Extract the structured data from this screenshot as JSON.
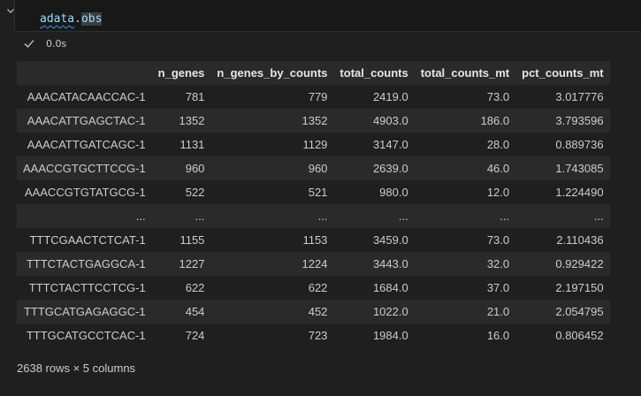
{
  "cell": {
    "code_var": "adata",
    "code_dot": ".",
    "code_attr": "obs",
    "exec_time": "0.0s"
  },
  "table": {
    "index_header": "",
    "columns": [
      "n_genes",
      "n_genes_by_counts",
      "total_counts",
      "total_counts_mt",
      "pct_counts_mt"
    ],
    "rows": [
      {
        "index": "AAACATACAACCAC-1",
        "cells": [
          "781",
          "779",
          "2419.0",
          "73.0",
          "3.017776"
        ]
      },
      {
        "index": "AAACATTGAGCTAC-1",
        "cells": [
          "1352",
          "1352",
          "4903.0",
          "186.0",
          "3.793596"
        ]
      },
      {
        "index": "AAACATTGATCAGC-1",
        "cells": [
          "1131",
          "1129",
          "3147.0",
          "28.0",
          "0.889736"
        ]
      },
      {
        "index": "AAACCGTGCTTCCG-1",
        "cells": [
          "960",
          "960",
          "2639.0",
          "46.0",
          "1.743085"
        ]
      },
      {
        "index": "AAACCGTGTATGCG-1",
        "cells": [
          "522",
          "521",
          "980.0",
          "12.0",
          "1.224490"
        ]
      },
      {
        "index": "...",
        "cells": [
          "...",
          "...",
          "...",
          "...",
          "..."
        ]
      },
      {
        "index": "TTTCGAACTCTCAT-1",
        "cells": [
          "1155",
          "1153",
          "3459.0",
          "73.0",
          "2.110436"
        ]
      },
      {
        "index": "TTTCTACTGAGGCA-1",
        "cells": [
          "1227",
          "1224",
          "3443.0",
          "32.0",
          "0.929422"
        ]
      },
      {
        "index": "TTTCTACTTCCTCG-1",
        "cells": [
          "622",
          "622",
          "1684.0",
          "37.0",
          "2.197150"
        ]
      },
      {
        "index": "TTTGCATGAGAGGC-1",
        "cells": [
          "454",
          "452",
          "1022.0",
          "21.0",
          "2.054795"
        ]
      },
      {
        "index": "TTTGCATGCCTCAC-1",
        "cells": [
          "724",
          "723",
          "1984.0",
          "16.0",
          "0.806452"
        ]
      }
    ]
  },
  "shape_note": "2638 rows × 5 columns",
  "icons": {
    "collapse": "chevron-down-icon",
    "status": "check-icon"
  },
  "colors": {
    "background": "#1f1f1f",
    "stripe": "#2a2a2a",
    "code_identifier": "#9cdcfe"
  }
}
